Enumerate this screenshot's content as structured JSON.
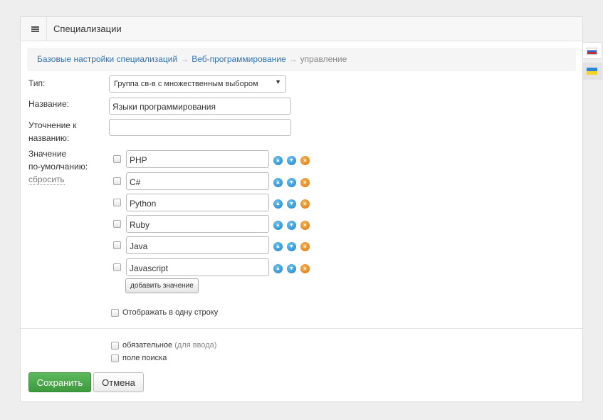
{
  "header": {
    "title": "Специализации"
  },
  "breadcrumb": {
    "items": [
      "Базовые настройки специализаций",
      "Веб-программирование"
    ],
    "current": "управление",
    "separator": "→"
  },
  "form": {
    "type_label": "Тип:",
    "type_value": "Группа св-в с множественным выбором",
    "name_label": "Название:",
    "name_value": "Языки программирования",
    "clarify_label_1": "Уточнение к",
    "clarify_label_2": "названию:",
    "clarify_value": "",
    "default_label_1": "Значение",
    "default_label_2": "по-умолчанию:",
    "reset_link": "сбросить",
    "values": [
      "PHP",
      "C#",
      "Python",
      "Ruby",
      "Java",
      "Javascript"
    ],
    "add_value_button": "добавить значение",
    "one_line_label": "Отображать в одну строку",
    "required_label": "обязательное",
    "required_hint": "(для ввода)",
    "search_field_label": "поле поиска"
  },
  "buttons": {
    "save": "Сохранить",
    "cancel": "Отмена"
  },
  "icons": {
    "up": "arrow-up-icon",
    "down": "arrow-down-icon",
    "delete": "delete-icon",
    "menu": "menu-icon",
    "lang_active": "flag-ru-icon",
    "lang_inactive": "flag-ua-icon"
  },
  "colors": {
    "save": "#4cae4c",
    "link": "#2e74b5",
    "move": "#1a7fc4",
    "delete": "#d9770e"
  }
}
